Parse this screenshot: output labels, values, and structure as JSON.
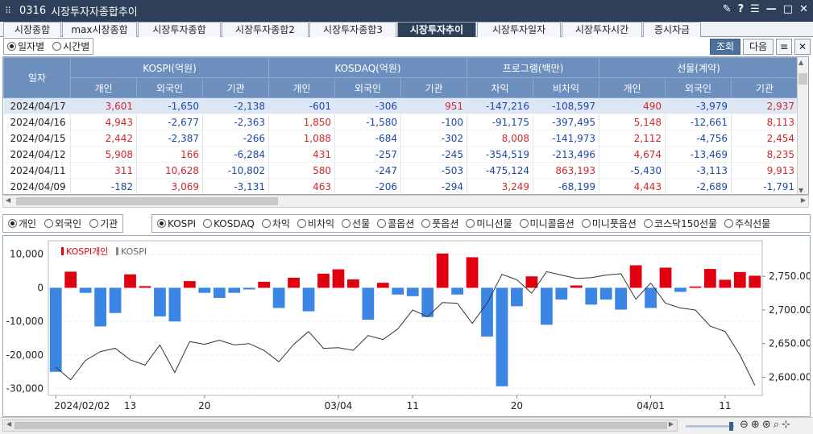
{
  "window": {
    "code": "0316",
    "title": "시장투자자종합추이",
    "controls": [
      "✎",
      "?",
      "☰",
      "—",
      "□",
      "✕"
    ]
  },
  "tabs": [
    {
      "label": "시장종합",
      "active": false
    },
    {
      "label": "max시장종합",
      "active": false
    },
    {
      "label": "시장투자종합",
      "active": false
    },
    {
      "label": "시장투자종합2",
      "active": false
    },
    {
      "label": "시장투자종합3",
      "active": false
    },
    {
      "label": "시장투자추이",
      "active": true
    },
    {
      "label": "시장투자일자",
      "active": false
    },
    {
      "label": "시장투자시간",
      "active": false
    },
    {
      "label": "증시자금",
      "active": false
    }
  ],
  "toolbar": {
    "period_daily": "일자별",
    "period_time": "시간별",
    "query_button": "조회",
    "next_button": "다음"
  },
  "table": {
    "date_header": "일자",
    "groups": [
      "KOSPI(억원)",
      "KOSDAQ(억원)",
      "프로그램(백만)",
      "선물(계약)"
    ],
    "subheaders": [
      "개인",
      "외국인",
      "기관",
      "개인",
      "외국인",
      "기관",
      "차익",
      "비차익",
      "개인",
      "외국인",
      "기관"
    ],
    "rows": [
      {
        "date": "2024/04/17",
        "values": [
          "3,601",
          "-1,650",
          "-2,138",
          "-601",
          "-306",
          "951",
          "-147,216",
          "-108,597",
          "490",
          "-3,979",
          "2,937"
        ]
      },
      {
        "date": "2024/04/16",
        "values": [
          "4,943",
          "-2,677",
          "-2,363",
          "1,850",
          "-1,580",
          "-100",
          "-91,175",
          "-397,495",
          "5,148",
          "-12,661",
          "8,113"
        ]
      },
      {
        "date": "2024/04/15",
        "values": [
          "2,442",
          "-2,387",
          "-266",
          "1,088",
          "-684",
          "-302",
          "8,008",
          "-141,973",
          "2,112",
          "-4,756",
          "2,454"
        ]
      },
      {
        "date": "2024/04/12",
        "values": [
          "5,908",
          "166",
          "-6,284",
          "431",
          "-257",
          "-245",
          "-354,519",
          "-213,496",
          "4,674",
          "-13,469",
          "8,235"
        ]
      },
      {
        "date": "2024/04/11",
        "values": [
          "311",
          "10,628",
          "-10,802",
          "580",
          "-247",
          "-503",
          "-475,124",
          "863,193",
          "-5,430",
          "-3,113",
          "9,913"
        ]
      },
      {
        "date": "2024/04/09",
        "values": [
          "-182",
          "3,069",
          "-3,131",
          "463",
          "-206",
          "-294",
          "3,249",
          "-68,199",
          "4,443",
          "-2,689",
          "-1,791"
        ]
      }
    ]
  },
  "investor_options": [
    {
      "label": "개인",
      "selected": true
    },
    {
      "label": "외국인",
      "selected": false
    },
    {
      "label": "기관",
      "selected": false
    }
  ],
  "market_options": [
    {
      "label": "KOSPI",
      "selected": true
    },
    {
      "label": "KOSDAQ",
      "selected": false
    },
    {
      "label": "차익",
      "selected": false
    },
    {
      "label": "비차익",
      "selected": false
    },
    {
      "label": "선물",
      "selected": false
    },
    {
      "label": "콜옵션",
      "selected": false
    },
    {
      "label": "풋옵션",
      "selected": false
    },
    {
      "label": "미니선물",
      "selected": false
    },
    {
      "label": "미니콜옵션",
      "selected": false
    },
    {
      "label": "미니풋옵션",
      "selected": false
    },
    {
      "label": "코스닥150선물",
      "selected": false
    },
    {
      "label": "주식선물",
      "selected": false
    }
  ],
  "chart_data": {
    "type": "bar",
    "legend": [
      "KOSPI개인",
      "KOSPI"
    ],
    "colors": {
      "positive": "#e0000f",
      "negative": "#3b86e4",
      "line": "#333333"
    },
    "yleft_ticks": [
      "10,000",
      "0",
      "-10,000",
      "-20,000",
      "-30,000"
    ],
    "yleft_range": [
      -32000,
      14000
    ],
    "yright_ticks": [
      "2,750.00",
      "2,700.00",
      "2,650.00",
      "2,600.00"
    ],
    "yright_range": [
      2573,
      2803
    ],
    "x_labels": [
      "2024/02/02",
      "13",
      "20",
      "03/04",
      "11",
      "20",
      "04/01",
      "11"
    ],
    "x_label_index": [
      0,
      5,
      10,
      19,
      24,
      31,
      40,
      45
    ],
    "bars": [
      -25000,
      4800,
      -1500,
      -11500,
      -7500,
      4000,
      500,
      -8500,
      -10000,
      2000,
      -1500,
      -3000,
      -1500,
      -500,
      1800,
      -6000,
      3000,
      -7000,
      4200,
      5500,
      2500,
      -9500,
      1500,
      -2000,
      -2500,
      -8700,
      10200,
      -2000,
      9100,
      -14500,
      -29300,
      -5500,
      3400,
      -11000,
      -3500,
      700,
      -5000,
      -3500,
      -6500,
      6700,
      -6000,
      6000,
      -1200,
      400,
      5600,
      2400,
      4700,
      3600
    ],
    "kospi_line": [
      2615,
      2596,
      2625,
      2638,
      2643,
      2626,
      2618,
      2648,
      2607,
      2653,
      2649,
      2655,
      2648,
      2650,
      2640,
      2623,
      2649,
      2668,
      2643,
      2644,
      2640,
      2662,
      2656,
      2672,
      2700,
      2690,
      2711,
      2710,
      2680,
      2710,
      2753,
      2745,
      2725,
      2757,
      2752,
      2747,
      2748,
      2752,
      2754,
      2716,
      2740,
      2710,
      2703,
      2700,
      2676,
      2668,
      2633,
      2588
    ]
  },
  "statusbar": {
    "zoom_icons": [
      "zoom-out",
      "zoom-in",
      "zoom-reset",
      "zoom-fit"
    ]
  }
}
